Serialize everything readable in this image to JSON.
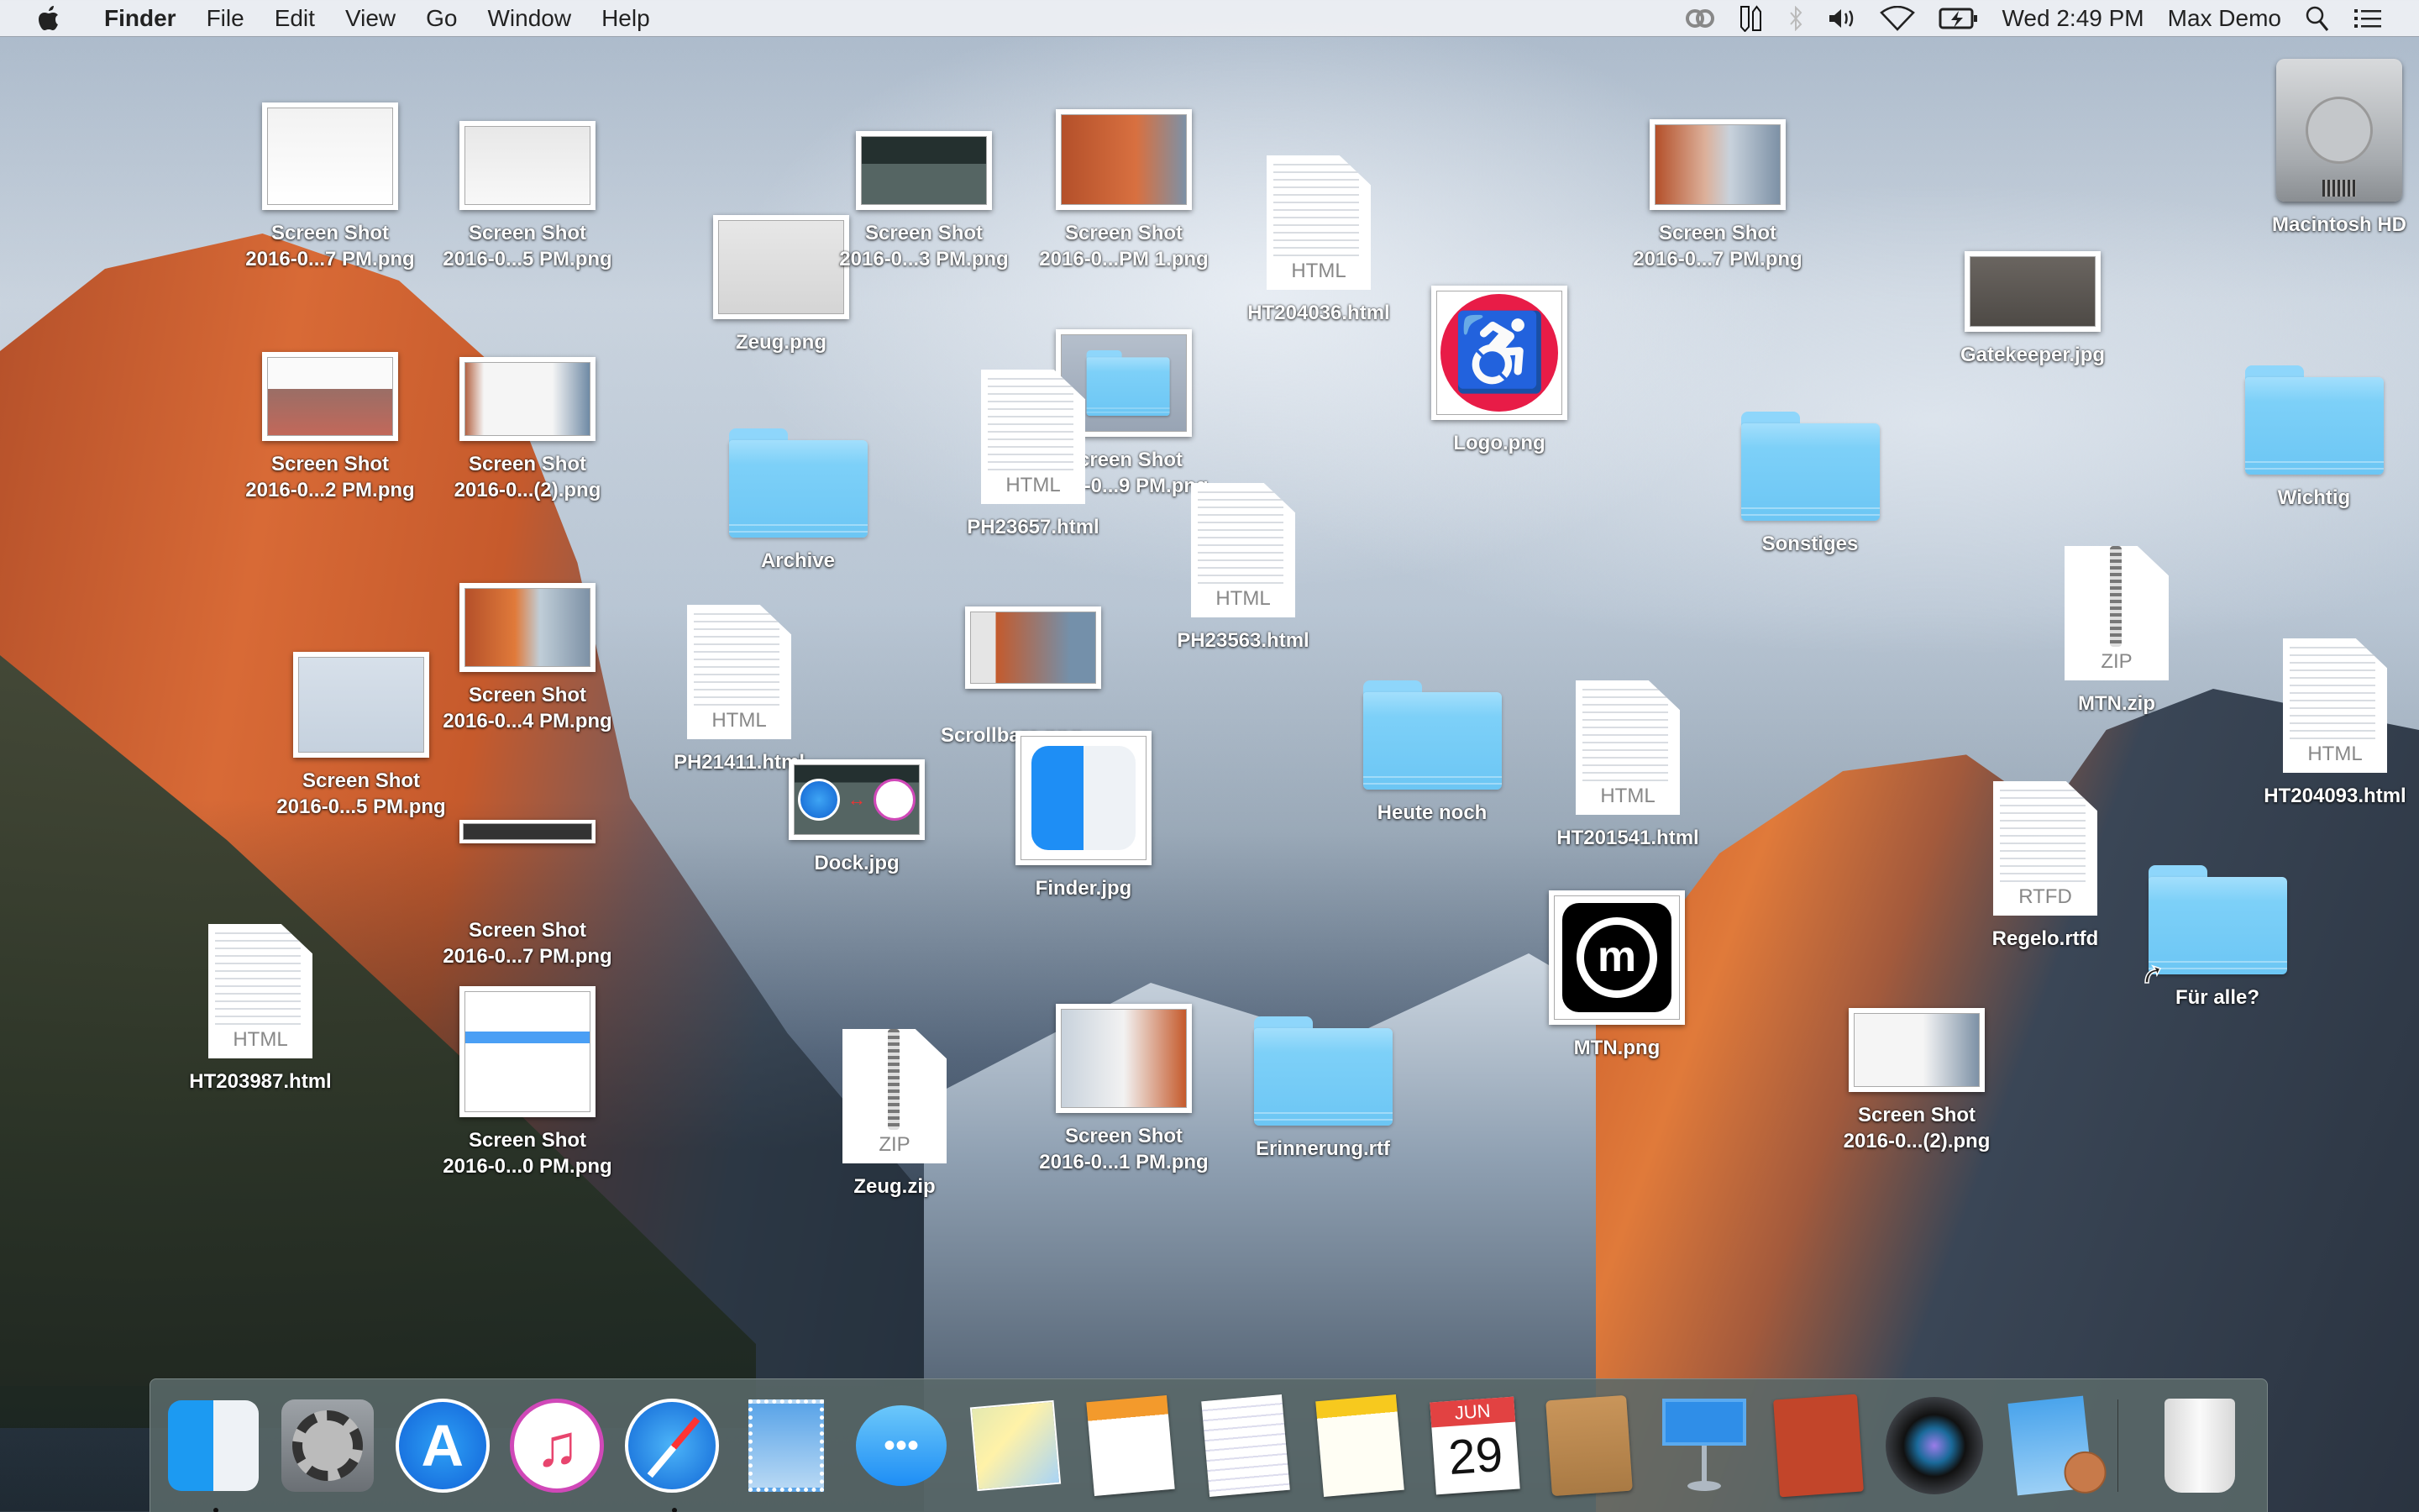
{
  "menubar": {
    "apple_icon": "apple-logo-icon",
    "app_name": "Finder",
    "menus": [
      "File",
      "Edit",
      "View",
      "Go",
      "Window",
      "Help"
    ],
    "status_icons": [
      "creative-cloud-icon",
      "dual-pencil-icon",
      "bluetooth-icon",
      "volume-icon",
      "wifi-icon",
      "battery-charging-icon"
    ],
    "clock": "Wed 2:49 PM",
    "user": "Max Demo",
    "spotlight_icon": "search-icon",
    "notification_icon": "notification-center-icon"
  },
  "desktop": {
    "items": [
      {
        "name": "Screen Shot",
        "name2": "2016-0...7 PM.png",
        "type": "screenshot"
      },
      {
        "name": "Screen Shot",
        "name2": "2016-0...5 PM.png",
        "type": "screenshot"
      },
      {
        "name": "Screen Shot",
        "name2": "2016-0...2 PM.png",
        "type": "screenshot"
      },
      {
        "name": "Screen Shot",
        "name2": "2016-0...(2).png",
        "type": "screenshot"
      },
      {
        "name": "Screen Shot",
        "name2": "2016-0...4 PM.png",
        "type": "screenshot"
      },
      {
        "name": "Screen Shot",
        "name2": "2016-0...5 PM.png",
        "type": "screenshot"
      },
      {
        "name": "Screen Shot",
        "name2": "2016-0...7 PM.png",
        "type": "screenshot"
      },
      {
        "name": "Screen Shot",
        "name2": "2016-0...0 PM.png",
        "type": "screenshot"
      },
      {
        "name": "HT203987.html",
        "type": "html",
        "ext": "HTML"
      },
      {
        "name": "Screen Shot",
        "name2": "2016-0...3 PM.png",
        "type": "screenshot"
      },
      {
        "name": "Screen Shot",
        "name2": "2016-0...PM 1.png",
        "type": "screenshot"
      },
      {
        "name": "Zeug.png",
        "type": "image"
      },
      {
        "name": "Screen Shot",
        "name2": "2016-0...9 PM.png",
        "type": "screenshot"
      },
      {
        "name": "PH23657.html",
        "type": "html",
        "ext": "HTML"
      },
      {
        "name": "Archive",
        "type": "folder"
      },
      {
        "name": "Scrollbars.png",
        "type": "image"
      },
      {
        "name": "PH21411.html",
        "type": "html",
        "ext": "HTML"
      },
      {
        "name": "Dock.jpg",
        "type": "image"
      },
      {
        "name": "Zeug.zip",
        "type": "zip",
        "ext": "ZIP"
      },
      {
        "name": "HT204036.html",
        "type": "html",
        "ext": "HTML"
      },
      {
        "name": "PH23563.html",
        "type": "html",
        "ext": "HTML"
      },
      {
        "name": "Finder.jpg",
        "type": "image"
      },
      {
        "name": "Screen Shot",
        "name2": "2016-0...1 PM.png",
        "type": "screenshot"
      },
      {
        "name": "Erinnerung.rtf",
        "type": "folder"
      },
      {
        "name": "Logo.png",
        "type": "image"
      },
      {
        "name": "Heute noch",
        "type": "folder"
      },
      {
        "name": "HT201541.html",
        "type": "html",
        "ext": "HTML"
      },
      {
        "name": "MTN.png",
        "type": "image"
      },
      {
        "name": "Screen Shot",
        "name2": "2016-0...7 PM.png",
        "type": "screenshot"
      },
      {
        "name": "Sonstiges",
        "type": "folder"
      },
      {
        "name": "Gatekeeper.jpg",
        "type": "image"
      },
      {
        "name": "MTN.zip",
        "type": "zip",
        "ext": "ZIP"
      },
      {
        "name": "Regelo.rtfd",
        "type": "rtfd",
        "ext": "RTFD"
      },
      {
        "name": "Screen Shot",
        "name2": "2016-0...(2).png",
        "type": "screenshot"
      },
      {
        "name": "Macintosh HD",
        "type": "disk"
      },
      {
        "name": "Wichtig",
        "type": "folder"
      },
      {
        "name": "HT204093.html",
        "type": "html",
        "ext": "HTML"
      },
      {
        "name": "Für alle?",
        "type": "folder-alias"
      }
    ]
  },
  "dock": {
    "apps": [
      {
        "name": "Finder",
        "icon": "finder-icon",
        "running": true
      },
      {
        "name": "System Preferences",
        "icon": "system-preferences-icon",
        "running": false
      },
      {
        "name": "App Store",
        "icon": "app-store-icon",
        "running": false
      },
      {
        "name": "iTunes",
        "icon": "itunes-icon",
        "running": false
      },
      {
        "name": "Safari",
        "icon": "safari-icon",
        "running": true
      },
      {
        "name": "Mail",
        "icon": "mail-icon",
        "running": false
      },
      {
        "name": "Messages",
        "icon": "messages-icon",
        "running": false
      },
      {
        "name": "Maps",
        "icon": "maps-icon",
        "running": false
      },
      {
        "name": "Pages",
        "icon": "pages-icon",
        "running": false
      },
      {
        "name": "TextEdit",
        "icon": "textedit-icon",
        "running": false
      },
      {
        "name": "Notes",
        "icon": "notes-icon",
        "running": false
      },
      {
        "name": "Calendar",
        "icon": "calendar-icon",
        "running": false,
        "month": "JUN",
        "day": "29"
      },
      {
        "name": "Contacts",
        "icon": "contacts-icon",
        "running": false
      },
      {
        "name": "Keynote",
        "icon": "keynote-icon",
        "running": false
      },
      {
        "name": "MacFamilyTree",
        "icon": "family-tree-icon",
        "running": false
      },
      {
        "name": "Camera Lens App",
        "icon": "camera-lens-icon",
        "running": false
      },
      {
        "name": "iFinance",
        "icon": "ifinance-icon",
        "running": false
      }
    ],
    "trash": {
      "name": "Trash",
      "icon": "trash-icon"
    }
  },
  "colors": {
    "folder_blue": "#7dd0f8",
    "menubar_bg": "#eef0f4",
    "dock_bg": "#5a6969"
  }
}
